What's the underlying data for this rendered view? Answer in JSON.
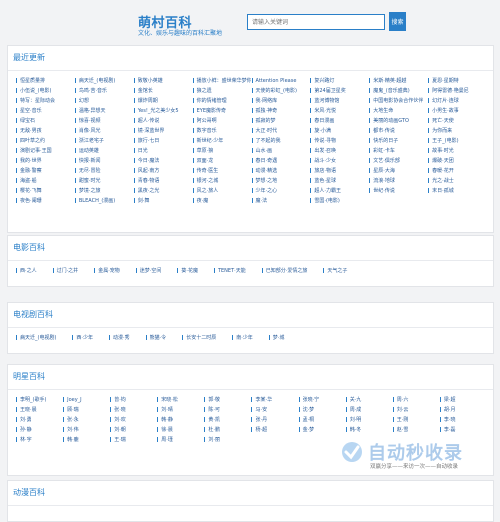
{
  "header": {
    "title": "萌村百科",
    "subtitle": "文化、娱乐与趣味的百科汇聚地",
    "search_placeholder": "请输入关键词",
    "search_button": "搜索"
  },
  "latest": {
    "title": "最近更新",
    "items": [
      "恒星质量排",
      "病天迁_(电视剧)",
      "致敬小英雄",
      "播放小鲜：盛世荣华梦你",
      "Attention Please",
      "复兴路灯",
      "米斯·精英·超越",
      "夏恩·星期特",
      "小伍说_(电影)",
      "鸟鸣·苦·音乐",
      "金馆长",
      "狼之遗",
      "天使的彩虹_(电影)",
      "第24届卫星奖",
      "魔鬼_(音乐盛典)",
      "阿得雷德·艳曼尼",
      "特写：星际动会",
      "幻想",
      "爆炸周期",
      "你的情绪管理",
      "我·网络库",
      "蓝河博物馆",
      "中国电影协会合作伙伴",
      "幻灯片·连球",
      "星空·音乐",
      "温格·异想天",
      "Yes!_光之美少女5",
      "EYE魔影传奇",
      "孤独·神奇",
      "米风·光悦",
      "大地生命",
      "小男生·故事",
      "绿宝石",
      "惊喜·视频",
      "超人·传说",
      "阿公哥啊",
      "孤寂的梦",
      "春日漫画",
      "美丽的动画GTO",
      "死亡·天使",
      "无敌·男孩",
      "肖像·风光",
      "镜·深蓝世界",
      "数字音乐",
      "大正·时代",
      "旋·小满",
      "都市·传说",
      "为你而来",
      "四叶草之约",
      "浙江老宅子",
      "旅行·七日",
      "新世纪·少年",
      "了不起的我",
      "传说·寻物",
      "快乐的日子",
      "王子_(电影)",
      "演剧记事·王国",
      "运动英雄",
      "日光",
      "草原·狼",
      "山水·画",
      "出发·召唤",
      "彩虹·卡车",
      "故事·时光",
      "我的·世界",
      "快报·新闻",
      "今日·魔法",
      "双面·龙",
      "春日·奇遇",
      "战斗·少女",
      "文艺·俱乐部",
      "爆破·天团",
      "金融·警察",
      "无尽·冒险",
      "风起·南方",
      "传奇·医生",
      "动漫·精选",
      "旅店·物语",
      "星辰·大海",
      "春暖·花开",
      "海盗·船",
      "甜蜜·时光",
      "青春·物语",
      "银河·之城",
      "梦想·之地",
      "蓝色·星球",
      "流浪·地球",
      "光之·战士",
      "樱花·飞舞",
      "梦境·之旅",
      "黑夜·之光",
      "风之·旅人",
      "少年·之心",
      "超人·力霸王",
      "世纪·传说",
      "末日·孤城",
      "夜色·阑珊",
      "BLEACH_(漫画)",
      "剑·舞",
      "夜·魔",
      "魔·法",
      "雪国·(电影)"
    ]
  },
  "movies": {
    "title": "电影百科",
    "items": [
      "西·之人",
      "过门·之井",
      "金属·宠物",
      "迷梦·空间",
      "葵·花魔",
      "TENET·天能",
      "已知部分·爱情之旅",
      "天气之子"
    ]
  },
  "tv": {
    "title": "电视剧百科",
    "items": [
      "病天迁_(电视剧)",
      "西·少年",
      "动漫·秀",
      "熊猫·令",
      "长安十二时辰",
      "南·少年",
      "梦·城"
    ]
  },
  "stars": {
    "title": "明星百科",
    "items": [
      "李明_(歌手)",
      "Joey_J",
      "曾·钧",
      "宋晓·松",
      "郭·敬",
      "李某·华",
      "张晓·宁",
      "关·九",
      "周·六",
      "梁·超",
      "王晓·晨",
      "顾·瑞",
      "张·晓",
      "刘·晴",
      "陈·可",
      "马·安",
      "沈·梦",
      "周·成",
      "刘·云",
      "胡·月",
      "刘·勇",
      "张·永",
      "刘·欢",
      "韩·静",
      "黄·凯",
      "张·丹",
      "孟·桐",
      "刘·明",
      "王·刚",
      "李·晓",
      "孙·静",
      "刘·伟",
      "刘·朝",
      "徐·晨",
      "杜·鹏",
      "杨·超",
      "金·梦",
      "韩·冬",
      "赵·雪",
      "李·磊",
      "林·宇",
      "韩·鹿",
      "王·瑞",
      "周·瑾",
      "刘·丽"
    ]
  },
  "anime": {
    "title": "动漫百科"
  },
  "watermark": {
    "brand": "自动秒收录",
    "slogan": "双赢分享——来访一次——自动收录"
  }
}
